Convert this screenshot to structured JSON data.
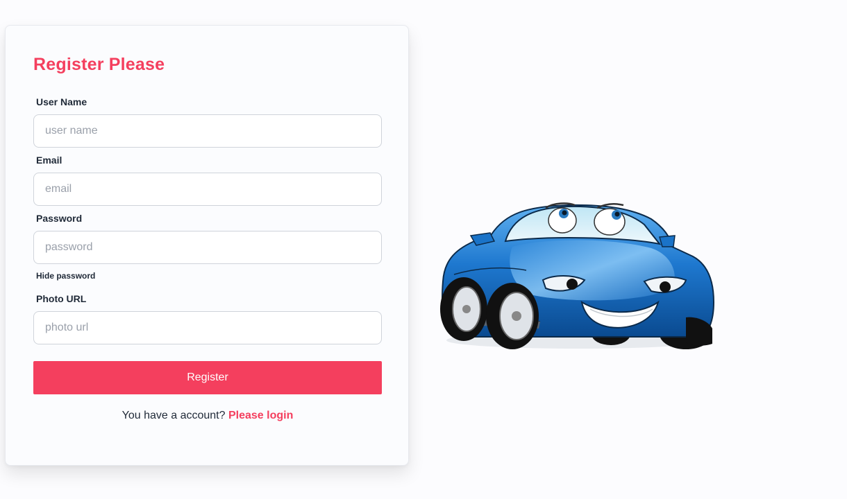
{
  "form": {
    "title": "Register Please",
    "fields": [
      {
        "label": "User Name",
        "placeholder": "user name",
        "value": ""
      },
      {
        "label": "Email",
        "placeholder": "email",
        "value": ""
      },
      {
        "label": "Password",
        "placeholder": "password",
        "value": ""
      },
      {
        "label": "Photo URL",
        "placeholder": "photo url",
        "value": ""
      }
    ],
    "toggle_password_label": "Hide password",
    "submit_label": "Register",
    "footer_text": "You have a account? ",
    "login_link_label": "Please login"
  },
  "illustration": {
    "name": "cartoon-blue-car",
    "colors": {
      "body": "#1a73c8",
      "body_dark": "#0b4f96",
      "accent": "#f43f5e"
    }
  }
}
